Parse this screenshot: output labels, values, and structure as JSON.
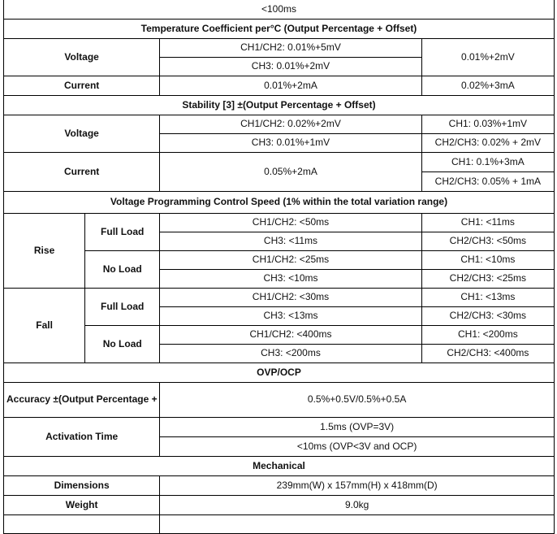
{
  "document": {
    "kind": "power-supply-specification-table",
    "top_partial_row": {
      "value": "<100ms"
    }
  },
  "sections": [
    {
      "id": "temperature-coefficient",
      "header": "Temperature Coefficient per°C (Output Percentage + Offset)",
      "rows": [
        {
          "label": "Voltage",
          "mid": [
            "CH1/CH2: 0.01%+5mV",
            "CH3: 0.01%+2mV"
          ],
          "right": [
            "0.01%+2mV"
          ]
        },
        {
          "label": "Current",
          "mid": [
            "0.01%+2mA"
          ],
          "right": [
            "0.02%+3mA"
          ]
        }
      ]
    },
    {
      "id": "stability",
      "header": "Stability [3] ±(Output Percentage + Offset)",
      "rows": [
        {
          "label": "Voltage",
          "mid": [
            "CH1/CH2: 0.02%+2mV",
            "CH3: 0.01%+1mV"
          ],
          "right": [
            "CH1: 0.03%+1mV",
            "CH2/CH3: 0.02% + 2mV"
          ]
        },
        {
          "label": "Current",
          "mid": [
            "0.05%+2mA"
          ],
          "right": [
            "CH1: 0.1%+3mA",
            "CH2/CH3: 0.05% + 1mA"
          ]
        }
      ]
    },
    {
      "id": "voltage-programming-control-speed",
      "header": "Voltage Programming Control Speed (1% within the total variation range)",
      "groups": [
        {
          "label": "Rise",
          "loads": [
            {
              "load": "Full Load",
              "mid": [
                "CH1/CH2: <50ms",
                "CH3: <11ms"
              ],
              "right": [
                "CH1: <11ms",
                "CH2/CH3: <50ms"
              ]
            },
            {
              "load": "No Load",
              "mid": [
                "CH1/CH2: <25ms",
                "CH3: <10ms"
              ],
              "right": [
                "CH1: <10ms",
                "CH2/CH3: <25ms"
              ]
            }
          ]
        },
        {
          "label": "Fall",
          "loads": [
            {
              "load": "Full Load",
              "mid": [
                "CH1/CH2: <30ms",
                "CH3: <13ms"
              ],
              "right": [
                "CH1: <13ms",
                "CH2/CH3: <30ms"
              ]
            },
            {
              "load": "No Load",
              "mid": [
                "CH1/CH2: <400ms",
                "CH3: <200ms"
              ],
              "right": [
                "CH1: <200ms",
                "CH2/CH3: <400ms"
              ]
            }
          ]
        }
      ]
    },
    {
      "id": "ovp-ocp",
      "header": "OVP/OCP",
      "rows": [
        {
          "label": "Accuracy ±(Output Percentage + Offset)",
          "value": "0.5%+0.5V/0.5%+0.5A"
        },
        {
          "label": "Activation Time",
          "values": [
            "1.5ms (OVP=3V)",
            "<10ms (OVP<3V and OCP)"
          ]
        }
      ]
    },
    {
      "id": "mechanical",
      "header": "Mechanical",
      "rows": [
        {
          "label": "Dimensions",
          "value": "239mm(W) x 157mm(H) x 418mm(D)"
        },
        {
          "label": "Weight",
          "value": "9.0kg"
        }
      ]
    }
  ]
}
